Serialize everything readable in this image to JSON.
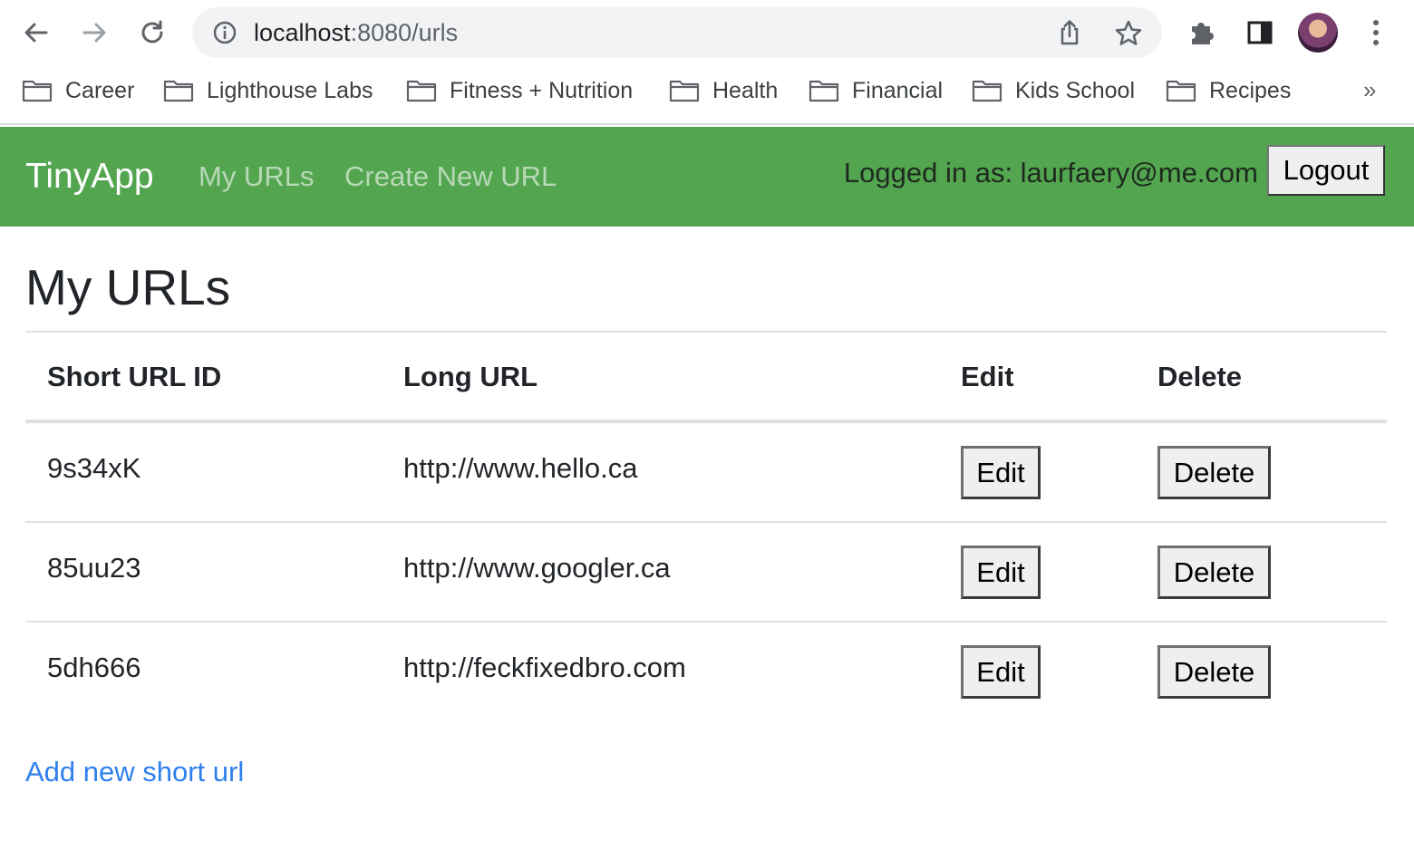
{
  "browser": {
    "url_host": "localhost",
    "url_rest": ":8080/urls",
    "bookmarks": [
      {
        "label": "Career"
      },
      {
        "label": "Lighthouse Labs"
      },
      {
        "label": "Fitness + Nutrition"
      },
      {
        "label": "Health"
      },
      {
        "label": "Financial"
      },
      {
        "label": "Kids School"
      },
      {
        "label": "Recipes"
      }
    ],
    "bookmarks_overflow": "»"
  },
  "navbar": {
    "brand": "TinyApp",
    "links": [
      {
        "label": "My URLs"
      },
      {
        "label": "Create New URL"
      }
    ],
    "logged_in_text": "Logged in as: laurfaery@me.com",
    "logout_label": "Logout",
    "bg_color": "#53a550"
  },
  "main": {
    "title": "My URLs",
    "table": {
      "headers": [
        "Short URL ID",
        "Long URL",
        "Edit",
        "Delete"
      ],
      "rows": [
        {
          "short_id": "9s34xK",
          "long_url": "http://www.hello.ca",
          "edit_label": "Edit",
          "delete_label": "Delete"
        },
        {
          "short_id": "85uu23",
          "long_url": "http://www.googler.ca",
          "edit_label": "Edit",
          "delete_label": "Delete"
        },
        {
          "short_id": "5dh666",
          "long_url": "http://feckfixedbro.com",
          "edit_label": "Edit",
          "delete_label": "Delete"
        }
      ]
    },
    "add_link": "Add new short url"
  }
}
